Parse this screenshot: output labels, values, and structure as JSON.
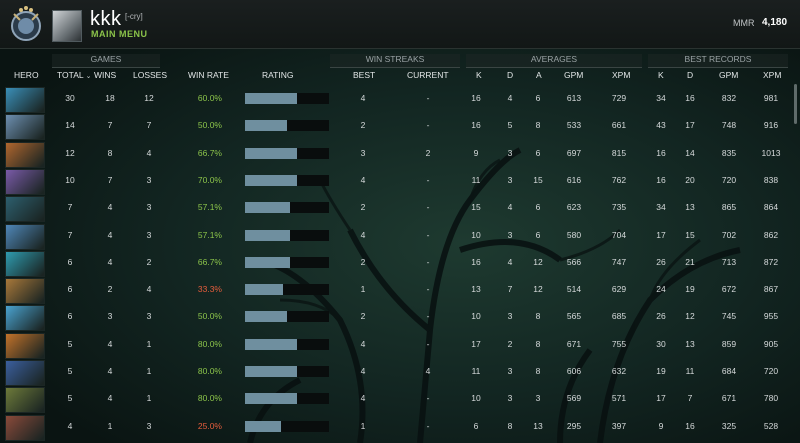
{
  "header": {
    "username": "kkk",
    "tag": "[-cry]",
    "menu_label": "MAIN MENU",
    "mmr_label": "MMR",
    "mmr_value": "4,180"
  },
  "groups": {
    "games": "GAMES",
    "streaks": "WIN STREAKS",
    "averages": "AVERAGES",
    "best": "BEST RECORDS"
  },
  "columns": {
    "hero": "HERO",
    "total": "TOTAL",
    "wins": "WINS",
    "losses": "LOSSES",
    "win_rate": "WIN RATE",
    "rating": "RATING",
    "best": "BEST",
    "current": "CURRENT",
    "k": "K",
    "d": "D",
    "a": "A",
    "gpm": "GPM",
    "xpm": "XPM",
    "best_k": "K",
    "best_d": "D",
    "best_gpm": "GPM",
    "best_xpm": "XPM"
  },
  "rows": [
    {
      "hero_color": "#3a8fb8",
      "total": "30",
      "wins": "18",
      "losses": "12",
      "win_rate": "60.0%",
      "rating": 0.62,
      "best": "4",
      "current": "-",
      "k": "16",
      "d": "4",
      "a": "6",
      "gpm": "613",
      "xpm": "729",
      "bk": "34",
      "bd": "16",
      "bgpm": "832",
      "bxpm": "981"
    },
    {
      "hero_color": "#6d8fb0",
      "total": "14",
      "wins": "7",
      "losses": "7",
      "win_rate": "50.0%",
      "rating": 0.5,
      "best": "2",
      "current": "-",
      "k": "16",
      "d": "5",
      "a": "8",
      "gpm": "533",
      "xpm": "661",
      "bk": "43",
      "bd": "17",
      "bgpm": "748",
      "bxpm": "916"
    },
    {
      "hero_color": "#b0662e",
      "total": "12",
      "wins": "8",
      "losses": "4",
      "win_rate": "66.7%",
      "rating": 0.62,
      "best": "3",
      "current": "2",
      "k": "9",
      "d": "3",
      "a": "6",
      "gpm": "697",
      "xpm": "815",
      "bk": "16",
      "bd": "14",
      "bgpm": "835",
      "bxpm": "1013"
    },
    {
      "hero_color": "#7a5aa8",
      "total": "10",
      "wins": "7",
      "losses": "3",
      "win_rate": "70.0%",
      "rating": 0.62,
      "best": "4",
      "current": "-",
      "k": "11",
      "d": "3",
      "a": "15",
      "gpm": "616",
      "xpm": "762",
      "bk": "16",
      "bd": "20",
      "bgpm": "720",
      "bxpm": "838"
    },
    {
      "hero_color": "#2d5f6e",
      "total": "7",
      "wins": "4",
      "losses": "3",
      "win_rate": "57.1%",
      "rating": 0.54,
      "best": "2",
      "current": "-",
      "k": "15",
      "d": "4",
      "a": "6",
      "gpm": "623",
      "xpm": "735",
      "bk": "34",
      "bd": "13",
      "bgpm": "865",
      "bxpm": "864"
    },
    {
      "hero_color": "#4f87b8",
      "total": "7",
      "wins": "4",
      "losses": "3",
      "win_rate": "57.1%",
      "rating": 0.54,
      "best": "4",
      "current": "-",
      "k": "10",
      "d": "3",
      "a": "6",
      "gpm": "580",
      "xpm": "704",
      "bk": "17",
      "bd": "15",
      "bgpm": "702",
      "bxpm": "862"
    },
    {
      "hero_color": "#2f9cb0",
      "total": "6",
      "wins": "4",
      "losses": "2",
      "win_rate": "66.7%",
      "rating": 0.54,
      "best": "2",
      "current": "-",
      "k": "16",
      "d": "4",
      "a": "12",
      "gpm": "566",
      "xpm": "747",
      "bk": "26",
      "bd": "21",
      "bgpm": "713",
      "bxpm": "872"
    },
    {
      "hero_color": "#a8783a",
      "total": "6",
      "wins": "2",
      "losses": "4",
      "win_rate": "33.3%",
      "rating": 0.45,
      "best": "1",
      "current": "-",
      "k": "13",
      "d": "7",
      "a": "12",
      "gpm": "514",
      "xpm": "629",
      "bk": "24",
      "bd": "19",
      "bgpm": "672",
      "bxpm": "867"
    },
    {
      "hero_color": "#4aa3d0",
      "total": "6",
      "wins": "3",
      "losses": "3",
      "win_rate": "50.0%",
      "rating": 0.5,
      "best": "2",
      "current": "-",
      "k": "10",
      "d": "3",
      "a": "8",
      "gpm": "565",
      "xpm": "685",
      "bk": "26",
      "bd": "12",
      "bgpm": "745",
      "bxpm": "955"
    },
    {
      "hero_color": "#c2722a",
      "total": "5",
      "wins": "4",
      "losses": "1",
      "win_rate": "80.0%",
      "rating": 0.62,
      "best": "4",
      "current": "-",
      "k": "17",
      "d": "2",
      "a": "8",
      "gpm": "671",
      "xpm": "755",
      "bk": "30",
      "bd": "13",
      "bgpm": "859",
      "bxpm": "905"
    },
    {
      "hero_color": "#3b5f9e",
      "total": "5",
      "wins": "4",
      "losses": "1",
      "win_rate": "80.0%",
      "rating": 0.62,
      "best": "4",
      "current": "4",
      "k": "11",
      "d": "3",
      "a": "8",
      "gpm": "606",
      "xpm": "632",
      "bk": "19",
      "bd": "11",
      "bgpm": "684",
      "bxpm": "720"
    },
    {
      "hero_color": "#6d7a3a",
      "total": "5",
      "wins": "4",
      "losses": "1",
      "win_rate": "80.0%",
      "rating": 0.62,
      "best": "4",
      "current": "-",
      "k": "10",
      "d": "3",
      "a": "3",
      "gpm": "569",
      "xpm": "571",
      "bk": "17",
      "bd": "7",
      "bgpm": "671",
      "bxpm": "780"
    },
    {
      "hero_color": "#8a4a3a",
      "total": "4",
      "wins": "1",
      "losses": "3",
      "win_rate": "25.0%",
      "rating": 0.43,
      "best": "1",
      "current": "-",
      "k": "6",
      "d": "8",
      "a": "13",
      "gpm": "295",
      "xpm": "397",
      "bk": "9",
      "bd": "16",
      "bgpm": "325",
      "bxpm": "528"
    }
  ]
}
